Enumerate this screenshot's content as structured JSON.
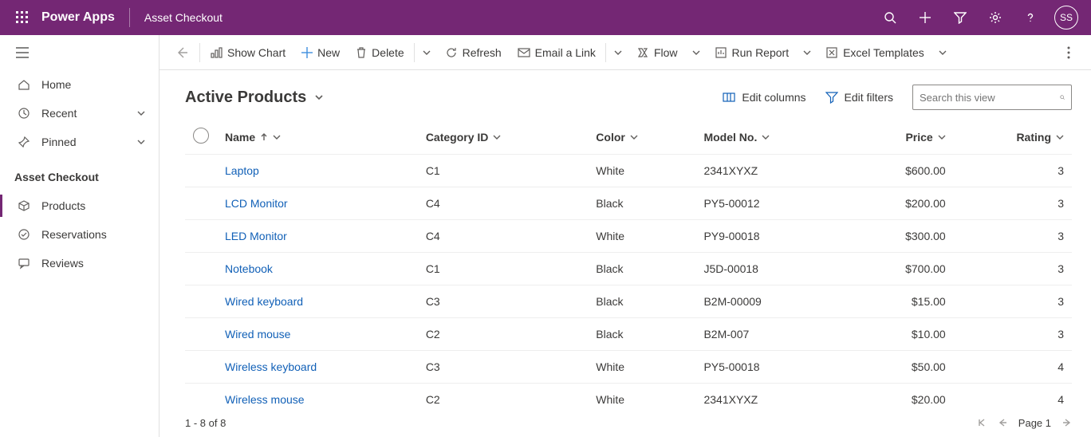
{
  "topbar": {
    "app_name": "Power Apps",
    "breadcrumb": "Asset Checkout",
    "avatar_initials": "SS"
  },
  "sidebar": {
    "items": [
      {
        "label": "Home"
      },
      {
        "label": "Recent"
      },
      {
        "label": "Pinned"
      }
    ],
    "group_title": "Asset Checkout",
    "group_items": [
      {
        "label": "Products"
      },
      {
        "label": "Reservations"
      },
      {
        "label": "Reviews"
      }
    ]
  },
  "commandbar": {
    "show_chart": "Show Chart",
    "new": "New",
    "delete": "Delete",
    "refresh": "Refresh",
    "email_link": "Email a Link",
    "flow": "Flow",
    "run_report": "Run Report",
    "excel_templates": "Excel Templates"
  },
  "view": {
    "title": "Active Products",
    "edit_columns": "Edit columns",
    "edit_filters": "Edit filters",
    "search_placeholder": "Search this view"
  },
  "columns": {
    "name": "Name",
    "category": "Category ID",
    "color": "Color",
    "model": "Model No.",
    "price": "Price",
    "rating": "Rating"
  },
  "rows": [
    {
      "name": "Laptop",
      "category": "C1",
      "color": "White",
      "model": "2341XYXZ",
      "price": "$600.00",
      "rating": "3"
    },
    {
      "name": "LCD Monitor",
      "category": "C4",
      "color": "Black",
      "model": "PY5-00012",
      "price": "$200.00",
      "rating": "3"
    },
    {
      "name": "LED Monitor",
      "category": "C4",
      "color": "White",
      "model": "PY9-00018",
      "price": "$300.00",
      "rating": "3"
    },
    {
      "name": "Notebook",
      "category": "C1",
      "color": "Black",
      "model": "J5D-00018",
      "price": "$700.00",
      "rating": "3"
    },
    {
      "name": "Wired keyboard",
      "category": "C3",
      "color": "Black",
      "model": "B2M-00009",
      "price": "$15.00",
      "rating": "3"
    },
    {
      "name": "Wired mouse",
      "category": "C2",
      "color": "Black",
      "model": "B2M-007",
      "price": "$10.00",
      "rating": "3"
    },
    {
      "name": "Wireless keyboard",
      "category": "C3",
      "color": "White",
      "model": "PY5-00018",
      "price": "$50.00",
      "rating": "4"
    },
    {
      "name": "Wireless mouse",
      "category": "C2",
      "color": "White",
      "model": "2341XYXZ",
      "price": "$20.00",
      "rating": "4"
    }
  ],
  "footer": {
    "range": "1 - 8 of 8",
    "page": "Page 1"
  }
}
